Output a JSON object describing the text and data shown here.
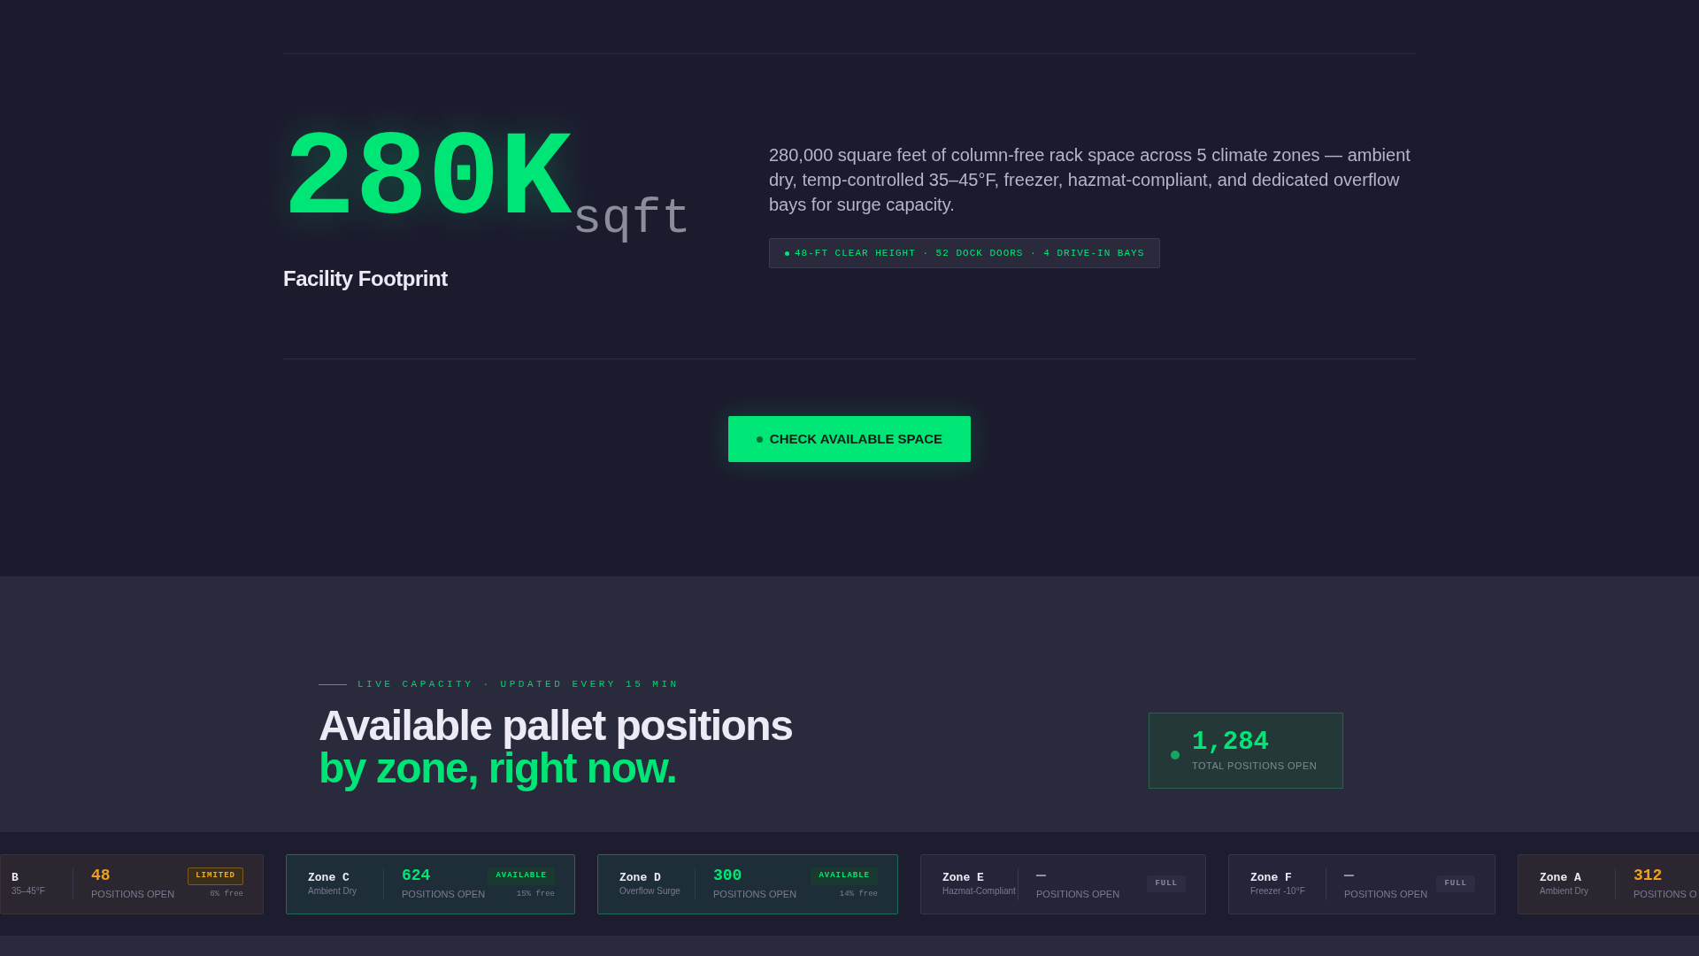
{
  "hero": {
    "value": "280K",
    "unit": "sqft",
    "label": "Facility Footprint",
    "description": "280,000 square feet of column-free rack space across 5 climate zones — ambient dry, temp-controlled 35–45°F, freezer, hazmat-compliant, and dedicated overflow bays for surge capacity.",
    "spec_tag": "48-FT CLEAR HEIGHT · 52 DOCK DOORS · 4 DRIVE-IN BAYS"
  },
  "cta_button": "CHECK AVAILABLE SPACE",
  "capacity": {
    "eyebrow": "LIVE CAPACITY · UPDATED EVERY 15 MIN",
    "heading_line_1": "Available pallet positions",
    "heading_line_2": "by zone, right now.",
    "total": "1,284",
    "total_label": "TOTAL POSITIONS OPEN"
  },
  "zones": [
    {
      "kind": "limited",
      "name": "B",
      "subtitle": "35–45°F",
      "count": "48",
      "count_label": "POSITIONS OPEN",
      "badge": "LIMITED",
      "free": "6% free"
    },
    {
      "kind": "available",
      "name": "Zone C",
      "subtitle": "Ambient Dry",
      "count": "624",
      "count_label": "POSITIONS OPEN",
      "badge": "AVAILABLE",
      "free": "15% free"
    },
    {
      "kind": "available",
      "name": "Zone D",
      "subtitle": "Overflow Surge",
      "count": "300",
      "count_label": "POSITIONS OPEN",
      "badge": "AVAILABLE",
      "free": "14% free"
    },
    {
      "kind": "full",
      "name": "Zone E",
      "subtitle": "Hazmat-Compliant",
      "count": "—",
      "count_label": "POSITIONS OPEN",
      "badge": "FULL"
    },
    {
      "kind": "full",
      "name": "Zone F",
      "subtitle": "Freezer -10°F",
      "count": "—",
      "count_label": "POSITIONS OPEN",
      "badge": "FULL"
    },
    {
      "kind": "limited",
      "name": "Zone A",
      "subtitle": "Ambient Dry",
      "count": "312",
      "count_label": "POSITIONS O"
    }
  ]
}
